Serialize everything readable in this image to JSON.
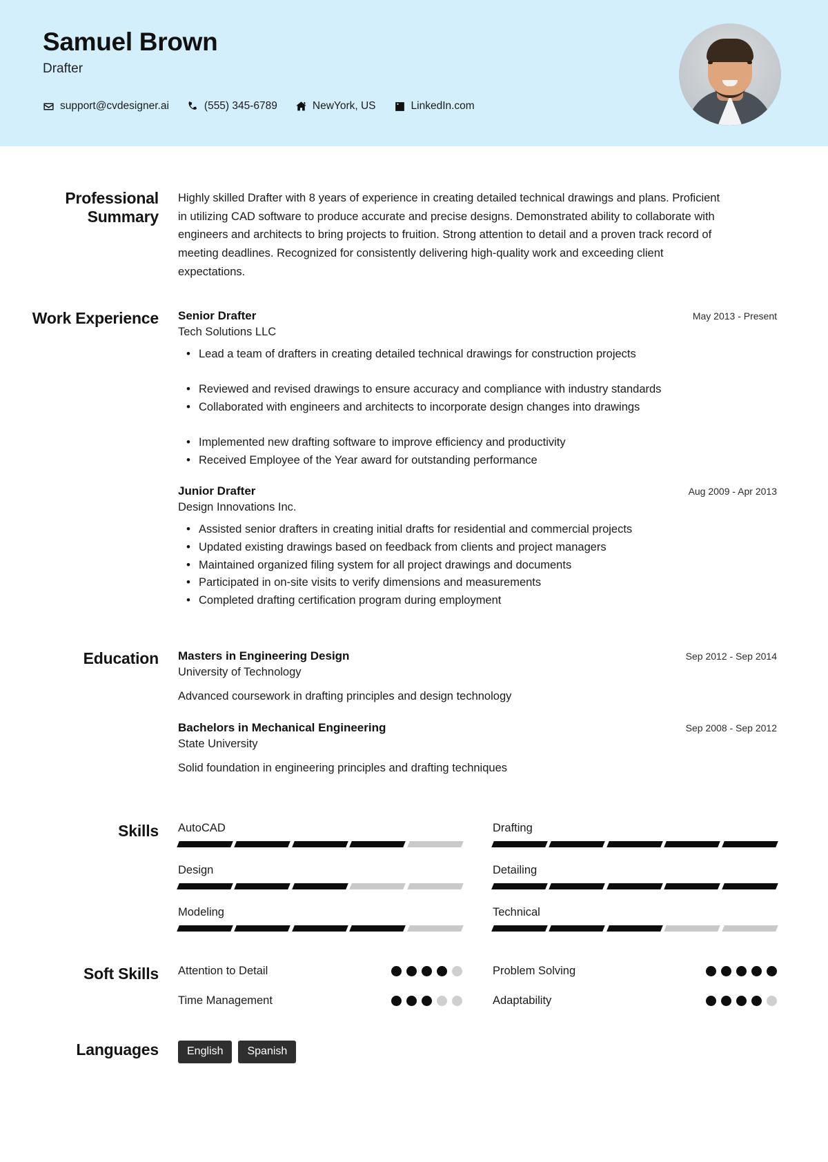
{
  "theme": {
    "header_bg": "#d3effc",
    "accent_dark": "#0d0d0d",
    "muted_bar": "#c9c9c9",
    "pill_bg": "#2f2f2f",
    "text": "#1b1b1b"
  },
  "header": {
    "name": "Samuel Brown",
    "job_title": "Drafter",
    "contacts": [
      {
        "icon": "envelope-icon",
        "text": "support@cvdesigner.ai"
      },
      {
        "icon": "phone-icon",
        "text": "(555) 345-6789"
      },
      {
        "icon": "home-icon",
        "text": "NewYork, US"
      },
      {
        "icon": "linkedin-icon",
        "text": "LinkedIn.com"
      }
    ],
    "avatar_alt": "profile-photo"
  },
  "sections": {
    "summary": {
      "label": "Professional Summary",
      "text": "Highly skilled Drafter with 8 years of experience in creating detailed technical drawings and plans. Proficient in utilizing CAD software to produce accurate and precise designs. Demonstrated ability to collaborate with engineers and architects to bring projects to fruition. Strong attention to detail and a proven track record of meeting deadlines. Recognized for consistently delivering high-quality work and exceeding client expectations."
    },
    "work": {
      "label": "Work Experience",
      "entries": [
        {
          "title": "Senior Drafter",
          "organization": "Tech Solutions LLC",
          "date": "May 2013 - Present",
          "bullets": [
            "Lead a team of drafters in creating detailed technical drawings for construction projects",
            "Reviewed and revised drawings to ensure accuracy and compliance with industry standards",
            "Collaborated with engineers and architects to incorporate design changes into drawings",
            "Implemented new drafting software to improve efficiency and productivity",
            "Received Employee of the Year award for outstanding performance"
          ]
        },
        {
          "title": "Junior Drafter",
          "organization": "Design Innovations Inc.",
          "date": "Aug 2009 - Apr 2013",
          "bullets": [
            "Assisted senior drafters in creating initial drafts for residential and commercial projects",
            "Updated existing drawings based on feedback from clients and project managers",
            "Maintained organized filing system for all project drawings and documents",
            "Participated in on-site visits to verify dimensions and measurements",
            "Completed drafting certification program during employment"
          ]
        }
      ]
    },
    "education": {
      "label": "Education",
      "entries": [
        {
          "degree": "Masters in Engineering Design",
          "school": "University of Technology",
          "date": "Sep 2012 - Sep 2014",
          "note": "Advanced coursework in drafting principles and design technology"
        },
        {
          "degree": "Bachelors in Mechanical Engineering",
          "school": "State University",
          "date": "Sep 2008 - Sep 2012",
          "note": "Solid foundation in engineering principles and drafting techniques"
        }
      ]
    },
    "skills": {
      "label": "Skills",
      "max_level": 5,
      "items": [
        {
          "name": "AutoCAD",
          "level": 4
        },
        {
          "name": "Drafting",
          "level": 5
        },
        {
          "name": "Design",
          "level": 3
        },
        {
          "name": "Detailing",
          "level": 5
        },
        {
          "name": "Modeling",
          "level": 4
        },
        {
          "name": "Technical",
          "level": 3
        }
      ]
    },
    "soft_skills": {
      "label": "Soft Skills",
      "max_level": 5,
      "items": [
        {
          "name": "Attention to Detail",
          "level": 4
        },
        {
          "name": "Problem Solving",
          "level": 5
        },
        {
          "name": "Time Management",
          "level": 3
        },
        {
          "name": "Adaptability",
          "level": 4
        }
      ]
    },
    "languages": {
      "label": "Languages",
      "items": [
        "English",
        "Spanish"
      ]
    }
  }
}
